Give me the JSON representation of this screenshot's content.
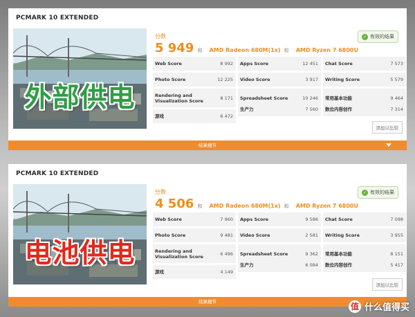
{
  "colors": {
    "accent": "#f08c1e",
    "bar": "#f08c2e",
    "overlay_green": "#2f9e44",
    "overlay_red": "#e12a1e",
    "valid_green": "#6eb13e"
  },
  "results": [
    {
      "title": "PCMARK 10 EXTENDED",
      "overlay_text": "外部供电",
      "score_label": "分数",
      "score": "5 949",
      "hw_gpu": "AMD Radeon 680M(1x)",
      "hw_and": "和",
      "hw_and2": "和",
      "hw_cpu": "AMD Ryzen 7 6800U",
      "valid_badge": "有效的结果",
      "compare_button": "添加以比较",
      "details_bar": "结果细节",
      "scores": [
        {
          "label": "Web Score",
          "value": "8 992"
        },
        {
          "label": "Apps Score",
          "value": "12 451"
        },
        {
          "label": "Chat Score",
          "value": "7 573"
        },
        {
          "label": "Photo Score",
          "value": "12 225"
        },
        {
          "label": "Video Score",
          "value": "3 917"
        },
        {
          "label": "Writing Score",
          "value": "5 579"
        },
        {
          "label": "Rendering and Visualization Score",
          "value": "8 171"
        },
        {
          "label": "Spreadsheet Score",
          "value": "10 246"
        },
        {
          "label": "常用基本功能",
          "value": "9 464"
        },
        {
          "label": "游戏",
          "value": "6 472"
        },
        {
          "label": "生产力",
          "value": "7 560"
        },
        {
          "label": "数位内容创作",
          "value": "7 314"
        }
      ]
    },
    {
      "title": "PCMARK 10 EXTENDED",
      "overlay_text": "电池供电",
      "score_label": "分数",
      "score": "4 506",
      "hw_gpu": "AMD Radeon 680M(1x)",
      "hw_and": "和",
      "hw_and2": "和",
      "hw_cpu": "AMD Ryzen 7 6800U",
      "valid_badge": "有效的结果",
      "compare_button": "添加以比较",
      "details_bar": "结果细节",
      "scores": [
        {
          "label": "Web Score",
          "value": "7 960"
        },
        {
          "label": "Apps Score",
          "value": "9 586"
        },
        {
          "label": "Chat Score",
          "value": "7 098"
        },
        {
          "label": "Photo Score",
          "value": "9 481"
        },
        {
          "label": "Video Score",
          "value": "2 581"
        },
        {
          "label": "Writing Score",
          "value": "3 955"
        },
        {
          "label": "Rendering and Visualization Score",
          "value": "6 496"
        },
        {
          "label": "Spreadsheet Score",
          "value": "9 362"
        },
        {
          "label": "常用基本功能",
          "value": "8 151"
        },
        {
          "label": "游戏",
          "value": "4 149"
        },
        {
          "label": "生产力",
          "value": "6 084"
        },
        {
          "label": "数位内容创作",
          "value": "5 417"
        }
      ]
    }
  ],
  "watermark": {
    "icon": "值",
    "text": "什么值得买"
  }
}
